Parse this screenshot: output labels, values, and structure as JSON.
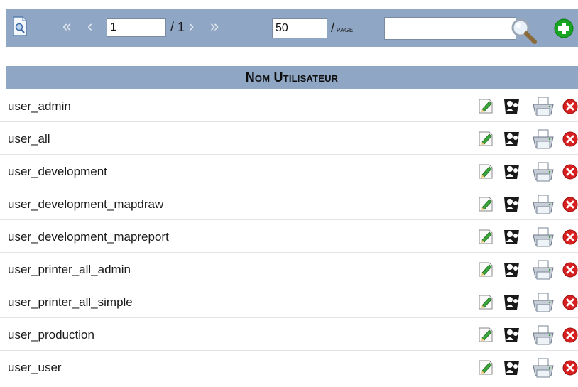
{
  "toolbar": {
    "page_value": "1",
    "page_total": "/ 1",
    "nav_first": "«",
    "nav_prev": "‹",
    "nav_next": "›",
    "nav_last": "»",
    "per_page_value": "50",
    "per_page_slash": "/",
    "per_page_word": "PAGE",
    "search_value": ""
  },
  "table": {
    "header": "Nom Utilisateur",
    "rows": [
      {
        "name": "user_admin"
      },
      {
        "name": "user_all"
      },
      {
        "name": "user_development"
      },
      {
        "name": "user_development_mapdraw"
      },
      {
        "name": "user_development_mapreport"
      },
      {
        "name": "user_printer_all_admin"
      },
      {
        "name": "user_printer_all_simple"
      },
      {
        "name": "user_production"
      },
      {
        "name": "user_user"
      }
    ],
    "row_actions": [
      "edit-icon",
      "user-permissions-icon",
      "printer-icon",
      "delete-icon"
    ]
  },
  "colors": {
    "toolbar_bg": "#8fa6c4",
    "header_bg": "#8fa6c4",
    "add_green": "#18a523",
    "delete_red": "#d81f1f"
  }
}
